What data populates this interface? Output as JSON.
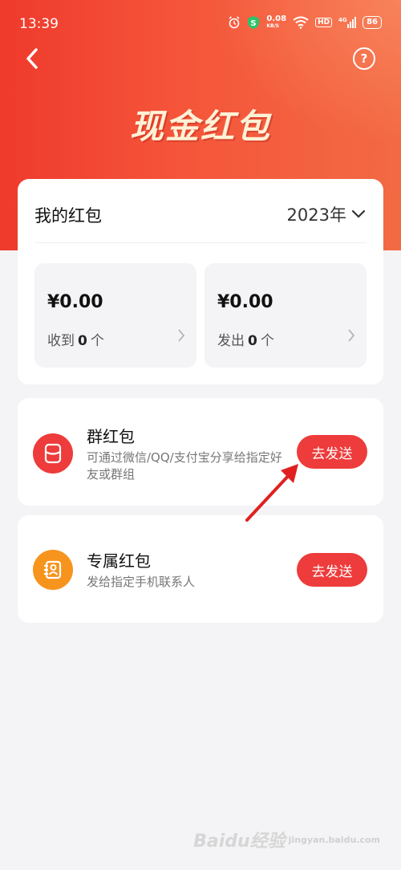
{
  "status_bar": {
    "time": "13:39",
    "net_speed_value": "0.08",
    "net_speed_unit": "KB/S",
    "hd_label": "HD",
    "signal_label": "4G",
    "battery": "86"
  },
  "header": {
    "title": "现金红包"
  },
  "wallet": {
    "title": "我的红包",
    "year": "2023年",
    "received": {
      "amount": "¥0.00",
      "label_prefix": "收到",
      "count": "0",
      "label_suffix": "个"
    },
    "sent": {
      "amount": "¥0.00",
      "label_prefix": "发出",
      "count": "0",
      "label_suffix": "个"
    }
  },
  "packet_types": {
    "group": {
      "name": "群红包",
      "description": "可通过微信/QQ/支付宝分享给指定好友或群组",
      "button": "去发送",
      "icon": "group-packet-icon"
    },
    "exclusive": {
      "name": "专属红包",
      "description": "发给指定手机联系人",
      "button": "去发送",
      "icon": "contact-card-icon"
    }
  },
  "watermark": {
    "text": "Baidu经验",
    "sub": "jingyan.baidu.com"
  },
  "colors": {
    "hero_red": "#ef3a2c",
    "button_red": "#ee3b3b",
    "exclusive_orange": "#f7941d"
  }
}
